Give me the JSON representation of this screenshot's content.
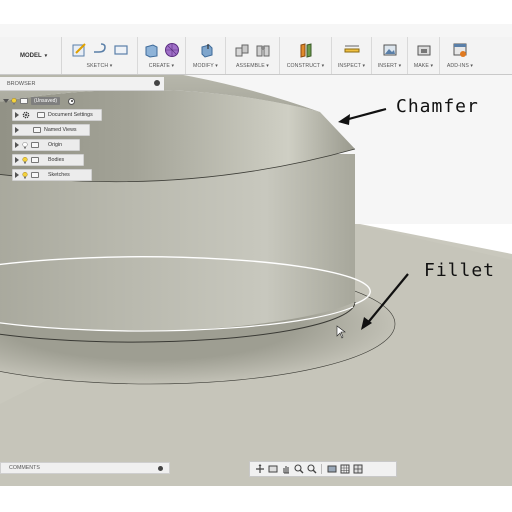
{
  "toolbar": {
    "workspace": "MODEL",
    "groups": [
      {
        "label": "SKETCH ▾"
      },
      {
        "label": "CREATE ▾"
      },
      {
        "label": "MODIFY ▾"
      },
      {
        "label": "ASSEMBLE ▾"
      },
      {
        "label": "CONSTRUCT ▾"
      },
      {
        "label": "INSPECT ▾"
      },
      {
        "label": "INSERT ▾"
      },
      {
        "label": "MAKE ▾"
      },
      {
        "label": "ADD-INS ▾"
      }
    ]
  },
  "browser": {
    "title": "BROWSER",
    "root_label": "(Unsaved)",
    "items": [
      {
        "label": "Document Settings"
      },
      {
        "label": "Named Views"
      },
      {
        "label": "Origin"
      },
      {
        "label": "Bodies"
      },
      {
        "label": "Sketches"
      }
    ]
  },
  "comments": {
    "label": "COMMENTS"
  },
  "annotations": {
    "chamfer": "Chamfer",
    "fillet": "Fillet"
  },
  "colors": {
    "background_plane": "#c9c8bd",
    "part_body": "#a9a99d",
    "toolbar": "#f3f3f3"
  },
  "icons": {
    "nav": [
      "orbit-icon",
      "pan-icon",
      "hand-icon",
      "zoom-icon",
      "zoom-window-icon",
      "display-icon",
      "grid-icon",
      "viewports-icon"
    ]
  }
}
